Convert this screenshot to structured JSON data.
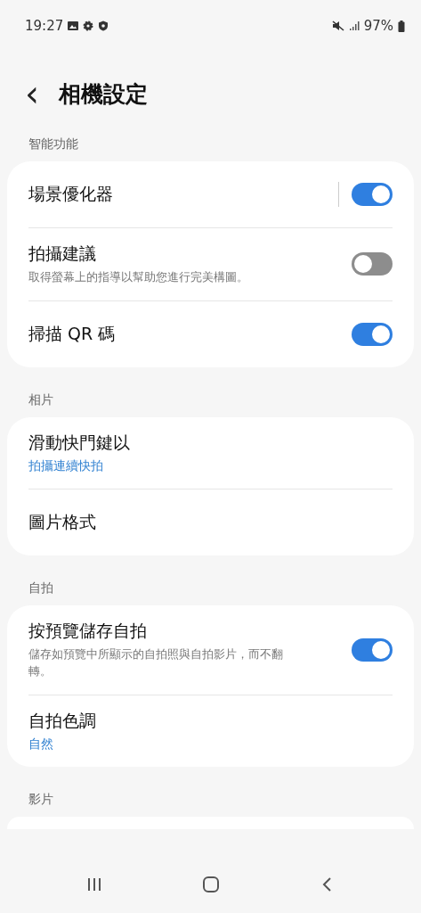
{
  "status_bar": {
    "time": "19:27",
    "battery": "97%"
  },
  "header": {
    "back": "‹",
    "title": "相機設定"
  },
  "sections": [
    {
      "label": "智能功能",
      "items": [
        {
          "kind": "toggle",
          "title": "場景優化器",
          "on": true,
          "split": true
        },
        {
          "kind": "toggle",
          "title": "拍攝建議",
          "subtitle": "取得螢幕上的指導以幫助您進行完美構圖。",
          "on": false,
          "split": false
        },
        {
          "kind": "toggle",
          "title": "掃描 QR 碼",
          "on": true,
          "split": false
        }
      ]
    },
    {
      "label": "相片",
      "items": [
        {
          "kind": "link",
          "title": "滑動快門鍵以",
          "value": "拍攝連續快拍"
        },
        {
          "kind": "link",
          "title": "圖片格式"
        }
      ]
    },
    {
      "label": "自拍",
      "items": [
        {
          "kind": "toggle",
          "title": "按預覽儲存自拍",
          "subtitle": "儲存如預覽中所顯示的自拍照與自拍影片，而不翻轉。",
          "on": true,
          "split": false
        },
        {
          "kind": "link",
          "title": "自拍色調",
          "value": "自然"
        }
      ]
    },
    {
      "label": "影片"
    }
  ]
}
